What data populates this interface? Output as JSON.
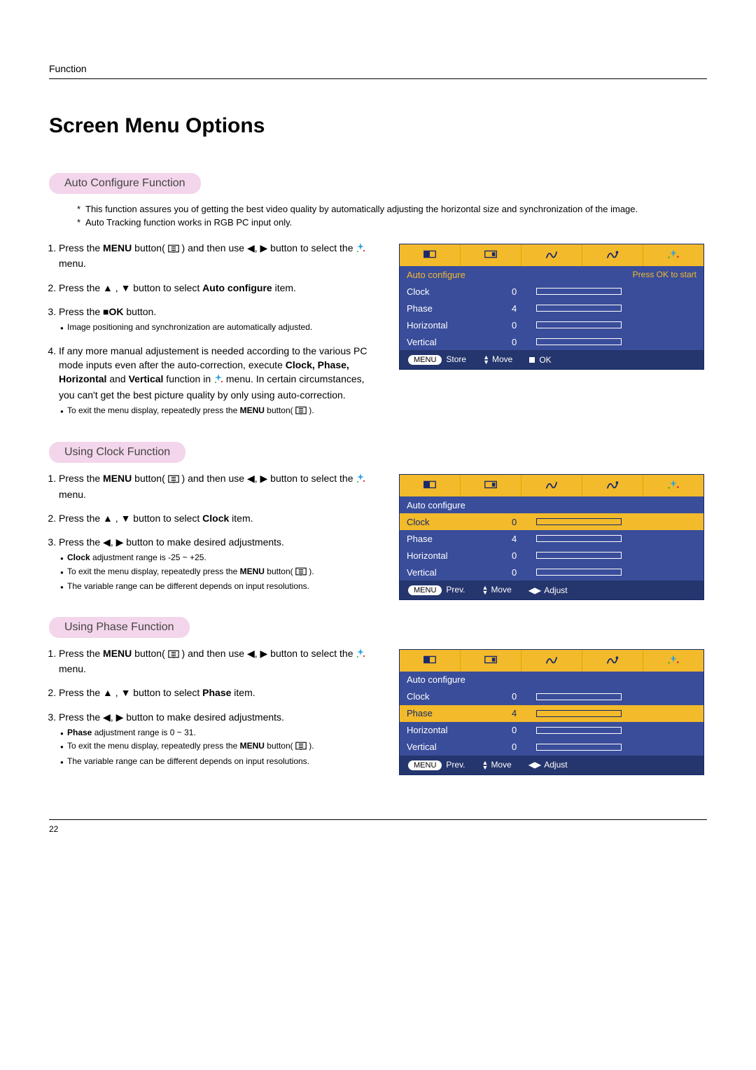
{
  "header_label": "Function",
  "page_title": "Screen Menu Options",
  "page_number": "22",
  "glyph": {
    "left": "◀",
    "right": "▶",
    "up": "▲",
    "down": "▼",
    "sq": "■"
  },
  "auto": {
    "heading": "Auto Configure Function",
    "intro": [
      "This function assures you of getting the best video quality by automatically adjusting the horizontal size and synchronization of the image.",
      "Auto Tracking function works in RGB PC input only."
    ],
    "s1a": "Press the ",
    "s1b": "MENU",
    "s1c": " button( ",
    "s1d": " ) and then use ",
    "s1e": " button to select the ",
    "s1f": " menu.",
    "s2a": "Press the ",
    "s2b": " button to select ",
    "s2c": "Auto configure",
    "s2d": " item.",
    "s3a": "Press the ",
    "s3b": "OK",
    "s3c": " button.",
    "s3_b1": "Image positioning and synchronization are automatically adjusted.",
    "s4a": "If any more manual adjustement is needed according to the various PC mode inputs even after the auto-correction, execute ",
    "s4b": "Clock, Phase, Horizontal",
    "s4c": " and ",
    "s4d": "Vertical",
    "s4e": " function in ",
    "s4f": " menu. In certain circumstances, you can't get the best picture quality by only using auto-correction.",
    "s4_b1a": "To exit the menu display, repeatedly press the ",
    "s4_b1b": "MENU",
    "s4_b1c": " button( ",
    "s4_b1d": " )."
  },
  "clock": {
    "heading": "Using Clock Function",
    "s1a": "Press the ",
    "s1b": "MENU",
    "s1c": " button( ",
    "s1d": " ) and then use ",
    "s1e": " button to select the ",
    "s1f": " menu.",
    "s2a": "Press the ",
    "s2b": " button to select ",
    "s2c": "Clock",
    "s2d": " item.",
    "s3a": "Press the ",
    "s3b": " button to make desired adjustments.",
    "b1a": "Clock",
    "b1b": " adjustment range is -25 ~ +25.",
    "b2a": "To exit the menu display, repeatedly press the ",
    "b2b": "MENU",
    "b2c": " button( ",
    "b2d": " ).",
    "b3": "The variable range can be different depends on input resolutions."
  },
  "phase_s": {
    "heading": "Using Phase Function",
    "s1a": "Press the ",
    "s1b": "MENU",
    "s1c": " button( ",
    "s1d": " ) and then use ",
    "s1e": " button to select the ",
    "s1f": " menu.",
    "s2a": "Press the ",
    "s2b": " button to select ",
    "s2c": "Phase",
    "s2d": " item.",
    "s3a": "Press the ",
    "s3b": " button to make desired adjustments.",
    "b1a": "Phase",
    "b1b": " adjustment range is 0 ~ 31.",
    "b2a": "To exit the menu display, repeatedly press the ",
    "b2b": "MENU",
    "b2c": " button( ",
    "b2d": " ).",
    "b3": "The variable range can be different depends on input resolutions."
  },
  "osd_auto": {
    "rows": [
      {
        "label": "Auto configure",
        "sel": "hi",
        "hint": "Press OK to start"
      },
      {
        "label": "Clock",
        "val": "0",
        "fill": 50
      },
      {
        "label": "Phase",
        "val": "4",
        "fill": 20
      },
      {
        "label": "Horizontal",
        "val": "0",
        "fill": 50
      },
      {
        "label": "Vertical",
        "val": "0",
        "fill": 50
      }
    ],
    "foot": {
      "menu": "MENU",
      "a": "Store",
      "b": "Move",
      "c": "OK",
      "mode": "ok"
    }
  },
  "osd_clock": {
    "rows": [
      {
        "label": "Auto configure"
      },
      {
        "label": "Clock",
        "val": "0",
        "fill": 50,
        "sel": "sel"
      },
      {
        "label": "Phase",
        "val": "4",
        "fill": 20
      },
      {
        "label": "Horizontal",
        "val": "0",
        "fill": 50
      },
      {
        "label": "Vertical",
        "val": "0",
        "fill": 50
      }
    ],
    "foot": {
      "menu": "MENU",
      "a": "Prev.",
      "b": "Move",
      "c": "Adjust",
      "mode": "lr"
    }
  },
  "osd_phase": {
    "rows": [
      {
        "label": "Auto configure"
      },
      {
        "label": "Clock",
        "val": "0",
        "fill": 50
      },
      {
        "label": "Phase",
        "val": "4",
        "fill": 20,
        "sel": "sel"
      },
      {
        "label": "Horizontal",
        "val": "0",
        "fill": 50
      },
      {
        "label": "Vertical",
        "val": "0",
        "fill": 50
      }
    ],
    "foot": {
      "menu": "MENU",
      "a": "Prev.",
      "b": "Move",
      "c": "Adjust",
      "mode": "lr"
    }
  }
}
